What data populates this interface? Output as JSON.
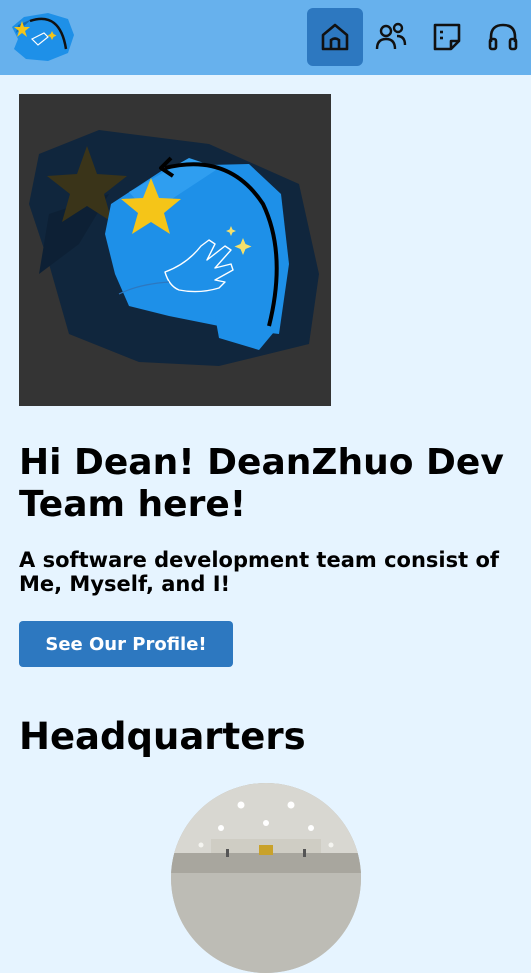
{
  "nav": {
    "items": [
      {
        "name": "home",
        "active": true
      },
      {
        "name": "team",
        "active": false
      },
      {
        "name": "notes",
        "active": false
      },
      {
        "name": "support",
        "active": false
      }
    ],
    "colors": {
      "bar": "#67b1ed",
      "active": "#2d78c0"
    }
  },
  "hero": {
    "title": "Hi Dean! DeanZhuo Dev Team here!",
    "subtitle": "A software development team consist of Me, Myself, and I!",
    "cta_label": "See Our Profile!"
  },
  "headquarters": {
    "heading": "Headquarters"
  },
  "colors": {
    "page_bg": "#e6f4ff",
    "brand_blue": "#1e90e8",
    "star_yellow": "#f5c518",
    "button": "#2d78c0"
  }
}
